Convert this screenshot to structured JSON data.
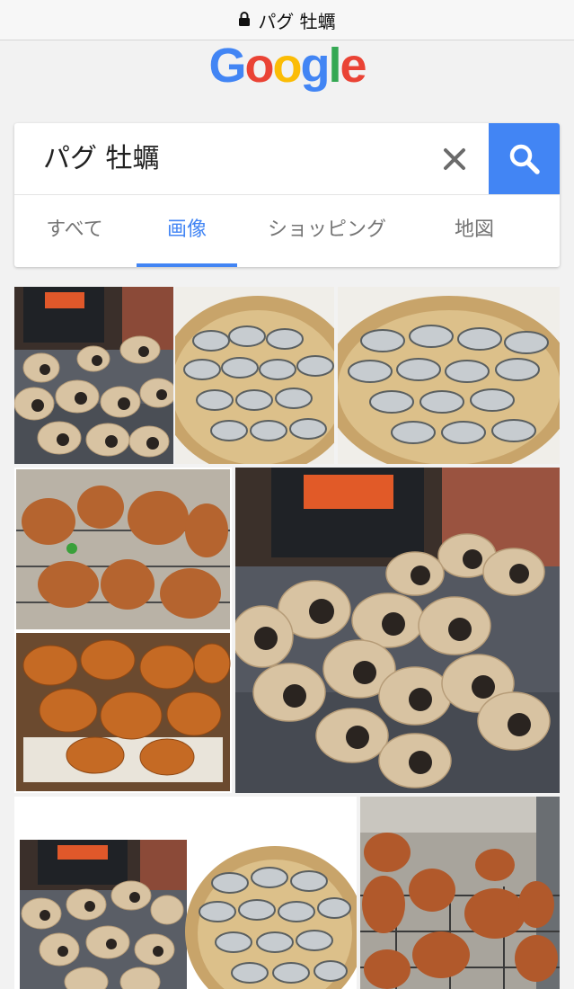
{
  "browser": {
    "address": "パグ 牡蠣"
  },
  "logo": {
    "letters": [
      "G",
      "o",
      "o",
      "g",
      "l",
      "e"
    ],
    "colors": [
      "#4285f4",
      "#ea4335",
      "#fbbc05",
      "#4285f4",
      "#34a853",
      "#ea4335"
    ]
  },
  "search": {
    "query": "パグ 牡蠣",
    "accent_color": "#4285f4"
  },
  "tabs": [
    {
      "label": "すべて",
      "active": false
    },
    {
      "label": "画像",
      "active": true
    },
    {
      "label": "ショッピング",
      "active": false
    },
    {
      "label": "地図",
      "active": false
    }
  ],
  "results": [
    {
      "subject": "pugs-by-stove"
    },
    {
      "subject": "oysters-in-basket"
    },
    {
      "subject": "oysters-in-basket"
    },
    {
      "subject": "poodles-and-fried-chicken"
    },
    {
      "subject": "pugs-by-stove"
    },
    {
      "subject": "pugs-and-oysters-collage"
    },
    {
      "subject": "poodles-on-rack"
    }
  ]
}
